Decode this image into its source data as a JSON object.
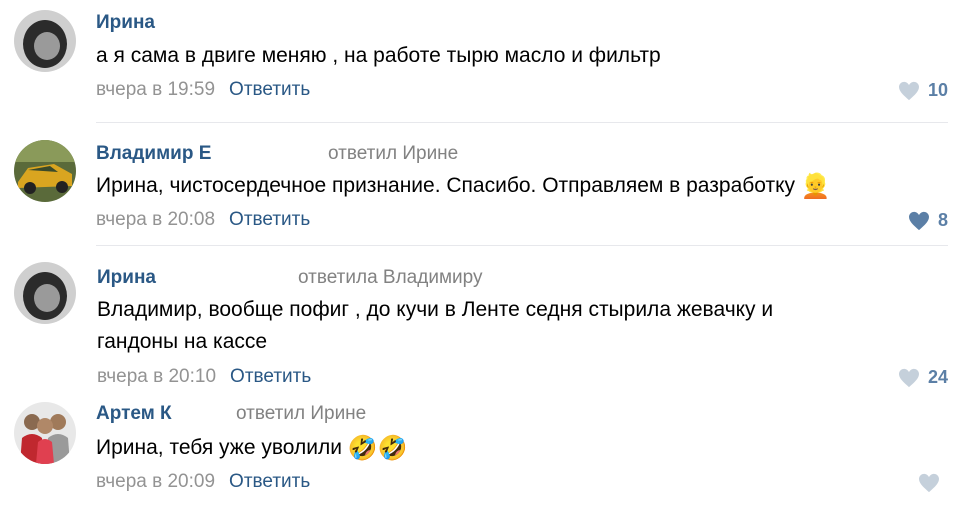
{
  "comments": [
    {
      "author": "Ирина",
      "reply_to": "",
      "text": "а я сама в двиге меняю , на работе тырю масло и фильтр",
      "date": "вчера в 19:59",
      "reply_label": "Ответить",
      "likes": "10"
    },
    {
      "author": "Владимир Е",
      "reply_to": "ответил Ирине",
      "text": "Ирина, чистосердечное признание. Спасибо. Отправляем в разработку",
      "emoji": "👱",
      "date": "вчера в 20:08",
      "reply_label": "Ответить",
      "likes": "8"
    },
    {
      "author": "Ирина",
      "reply_to": "ответила Владимиру",
      "text_line1": "Владимир, вообще пофиг , до кучи в Ленте седня стырила жевачку и",
      "text_line2": "гандоны на кассе",
      "date": "вчера в 20:10",
      "reply_label": "Ответить",
      "likes": "24"
    },
    {
      "author": "Артем К",
      "reply_to": "ответил Ирине",
      "text": "Ирина, тебя уже уволили",
      "emoji": "🤣🤣",
      "date": "вчера в 20:09",
      "reply_label": "Ответить",
      "likes": ""
    }
  ],
  "colors": {
    "link": "#2a5885",
    "muted": "#939393",
    "like_gray": "#c5d0db",
    "like_blue": "#5b7fa6"
  }
}
